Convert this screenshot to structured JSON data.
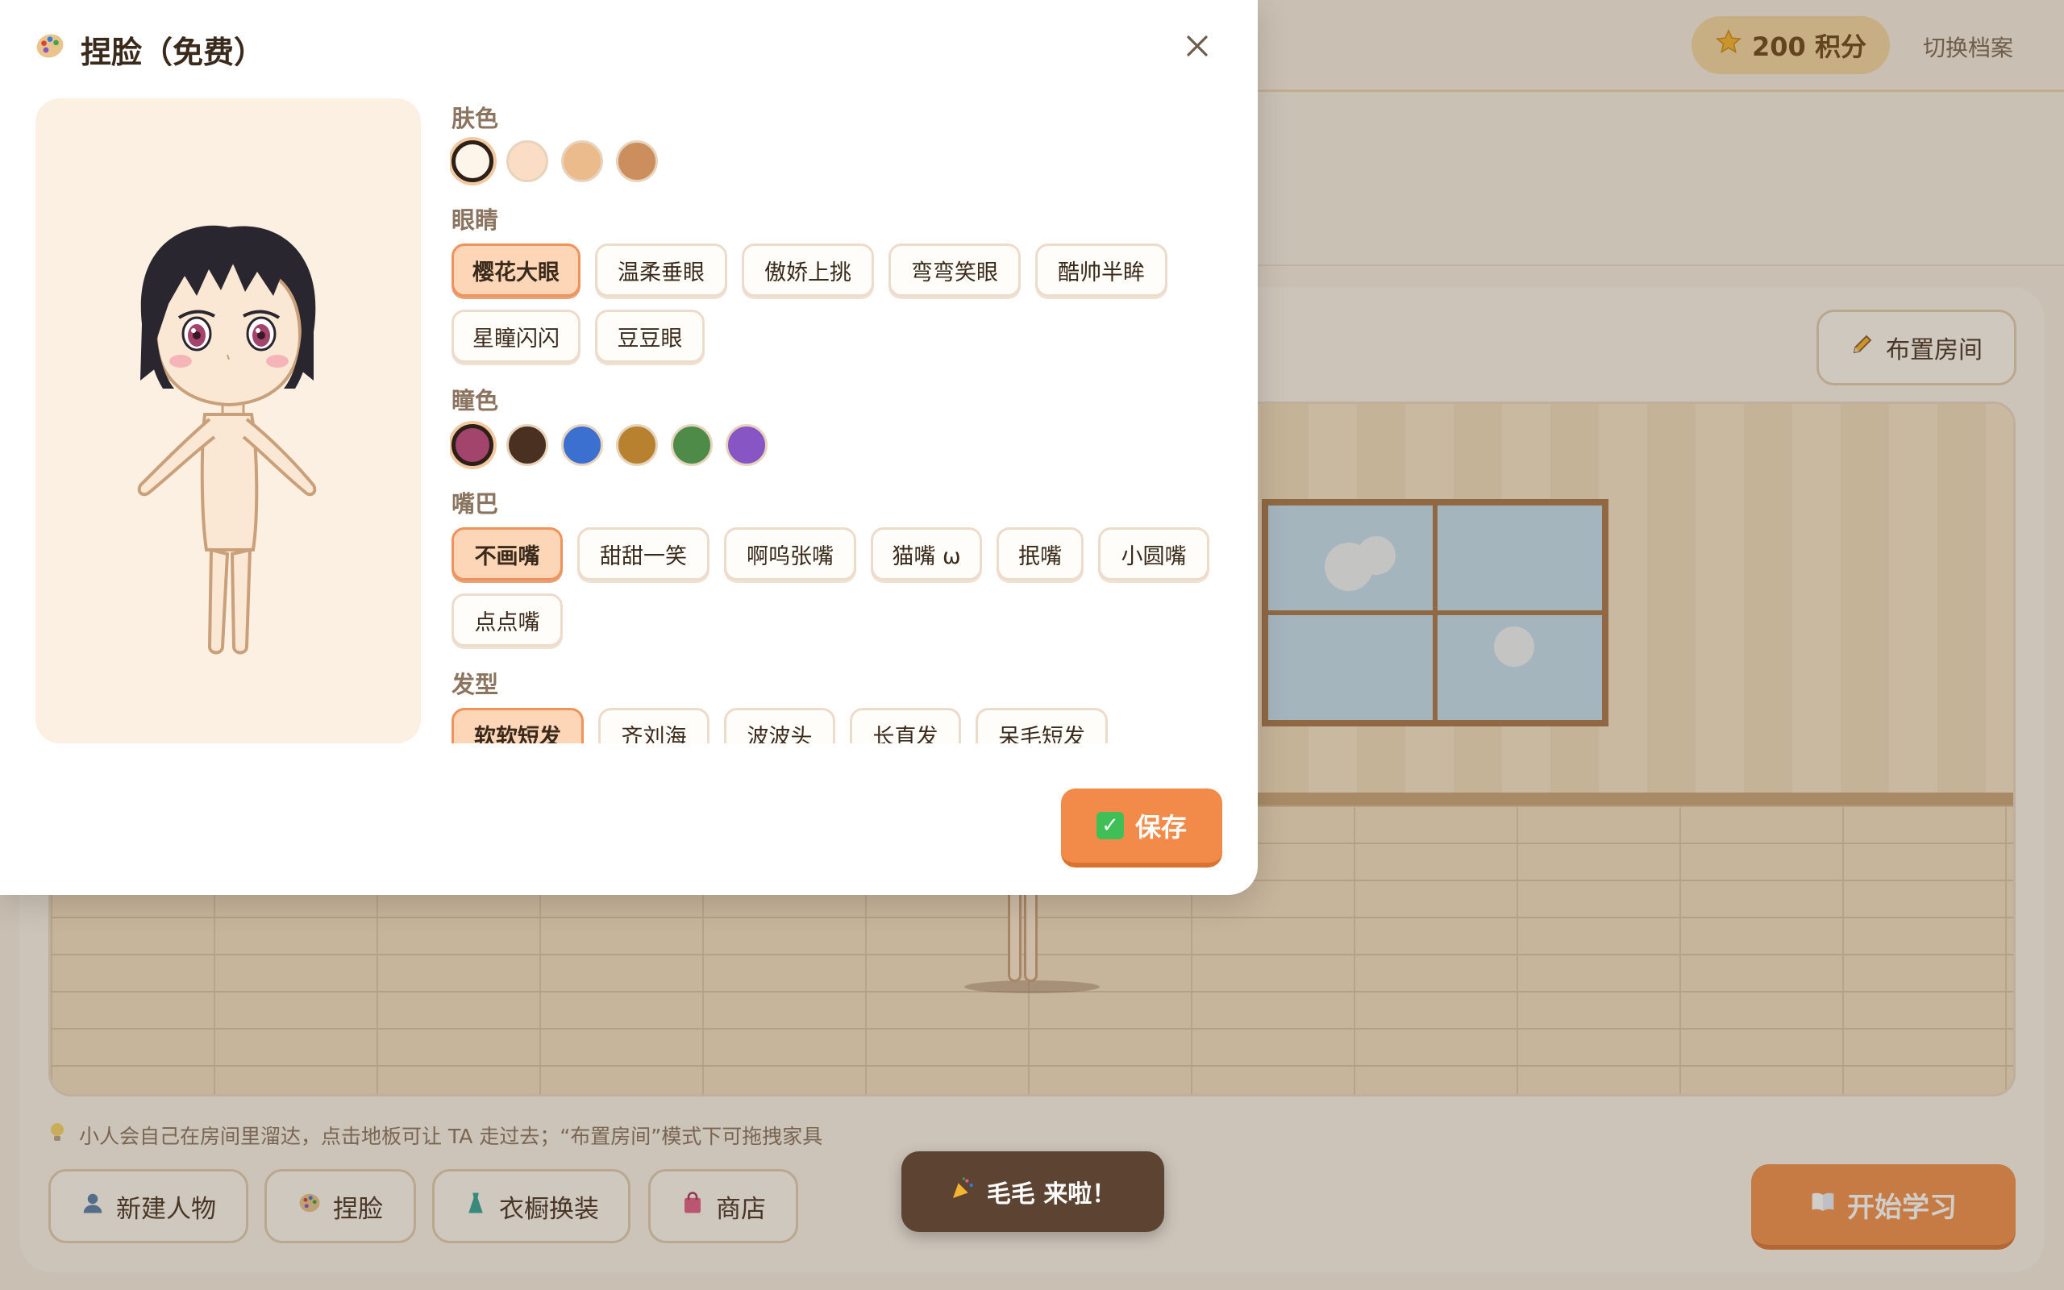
{
  "modal": {
    "title": "捏脸（免费）",
    "title_icon": "palette-icon",
    "close_icon": "close-icon",
    "save_label": "保存",
    "save_icon": "check-icon"
  },
  "skin": {
    "label": "肤色",
    "colors": [
      "#fdf4ea",
      "#fbdcc4",
      "#ecbb8c",
      "#cc8e5c"
    ],
    "selected": 0
  },
  "eyes": {
    "label": "眼睛",
    "options": [
      "樱花大眼",
      "温柔垂眼",
      "傲娇上挑",
      "弯弯笑眼",
      "酷帅半眸",
      "星瞳闪闪",
      "豆豆眼"
    ],
    "selected": 0
  },
  "pupil": {
    "label": "瞳色",
    "colors": [
      "#a2446c",
      "#4a3020",
      "#3b6fd0",
      "#b8812f",
      "#4e8a48",
      "#8856c4"
    ],
    "selected": 0
  },
  "mouth": {
    "label": "嘴巴",
    "options": [
      "不画嘴",
      "甜甜一笑",
      "啊呜张嘴",
      "猫嘴 ω",
      "抿嘴",
      "小圆嘴",
      "点点嘴"
    ],
    "selected": 0
  },
  "hair": {
    "label": "发型",
    "options": [
      "软软短发",
      "齐刘海",
      "波波头",
      "长直发",
      "呆毛短发"
    ],
    "selected": 0
  },
  "app": {
    "points_label": "200 积分",
    "switch_profile": "切换档案",
    "arrange_room": "布置房间",
    "hint": "小人会自己在房间里溜达，点击地板可让 TA 走过去；“布置房间”模式下可拖拽家具",
    "new_character": "新建人物",
    "face_edit": "捏脸",
    "wardrobe": "衣橱换装",
    "shop": "商店",
    "toast": "毛毛 来啦！",
    "start_study": "开始学习"
  }
}
